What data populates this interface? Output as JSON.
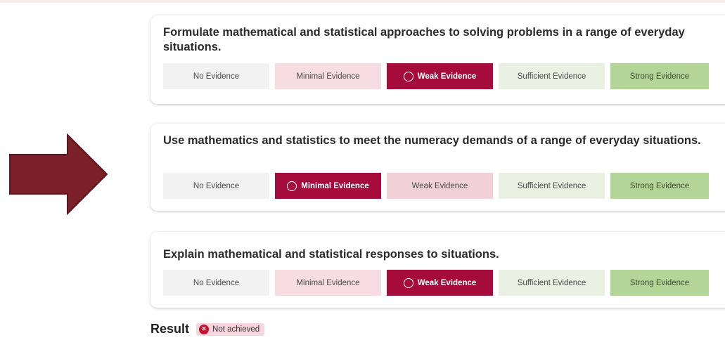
{
  "colors": {
    "arrow_fill": "#7b1f28",
    "selected": "#a50b3b",
    "minimal": "#f7dde2",
    "weak": "#f2d0d7",
    "sufficient": "#eaf1e3",
    "strong": "#b3d698",
    "no_evidence": "#f2f2f2",
    "not_achieved_icon": "#c8102e"
  },
  "criteria": [
    {
      "title": "Formulate mathematical and statistical approaches to solving problems in a range of everyday situations.",
      "options": [
        "No Evidence",
        "Minimal Evidence",
        "Weak Evidence",
        "Sufficient Evidence",
        "Strong Evidence"
      ],
      "selected": "Weak Evidence"
    },
    {
      "title": "Use mathematics and statistics to meet the numeracy demands of a range of everyday situations.",
      "options": [
        "No Evidence",
        "Minimal Evidence",
        "Weak Evidence",
        "Sufficient Evidence",
        "Strong Evidence"
      ],
      "selected": "Minimal Evidence"
    },
    {
      "title": "Explain mathematical and statistical responses to situations.",
      "options": [
        "No Evidence",
        "Minimal Evidence",
        "Weak Evidence",
        "Sufficient Evidence",
        "Strong Evidence"
      ],
      "selected": "Weak Evidence"
    }
  ],
  "result": {
    "label": "Result",
    "status": "Not achieved",
    "status_icon": "x-circle-icon"
  },
  "decor": {
    "pointer_icon": "right-arrow-icon"
  }
}
